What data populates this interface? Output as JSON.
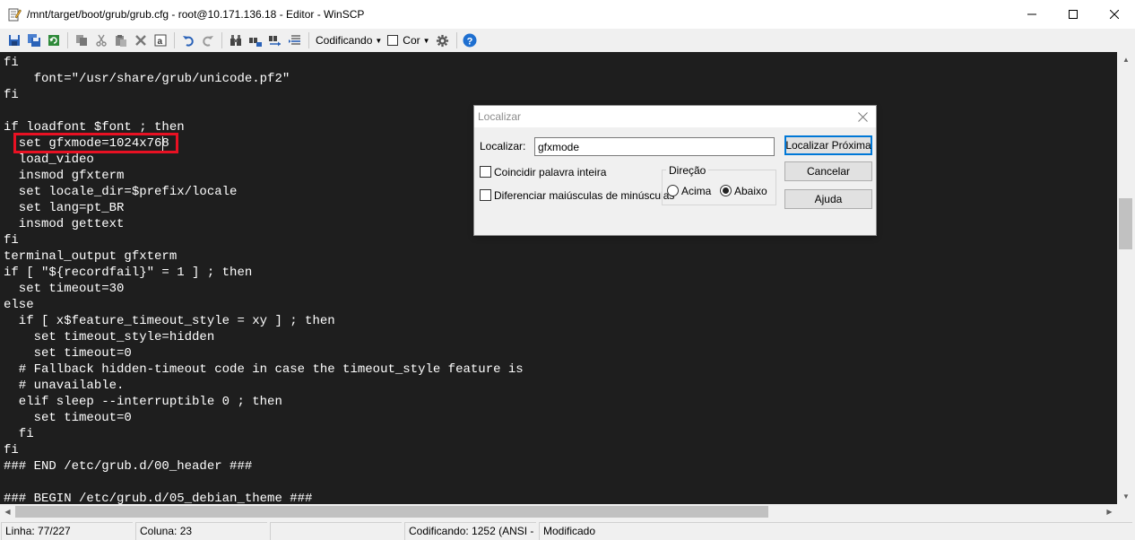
{
  "window": {
    "title": "/mnt/target/boot/grub/grub.cfg - root@10.171.136.18 - Editor - WinSCP"
  },
  "toolbar": {
    "encoding_label": "Codificando",
    "color_label": "Cor"
  },
  "editor": {
    "lines": [
      "fi",
      "    font=\"/usr/share/grub/unicode.pf2\"",
      "fi",
      "",
      "if loadfont $font ; then",
      "  set gfxmode=1024x768",
      "  load_video",
      "  insmod gfxterm",
      "  set locale_dir=$prefix/locale",
      "  set lang=pt_BR",
      "  insmod gettext",
      "fi",
      "terminal_output gfxterm",
      "if [ \"${recordfail}\" = 1 ] ; then",
      "  set timeout=30",
      "else",
      "  if [ x$feature_timeout_style = xy ] ; then",
      "    set timeout_style=hidden",
      "    set timeout=0",
      "  # Fallback hidden-timeout code in case the timeout_style feature is",
      "  # unavailable.",
      "  elif sleep --interruptible 0 ; then",
      "    set timeout=0",
      "  fi",
      "fi",
      "### END /etc/grub.d/00_header ###",
      "",
      "### BEGIN /etc/grub.d/05_debian_theme ###"
    ]
  },
  "statusbar": {
    "line": "Linha: 77/227",
    "column": "Coluna: 23",
    "encoding": "Codificando: 1252  (ANSI -",
    "state": "Modificado"
  },
  "find_dialog": {
    "title": "Localizar",
    "find_label": "Localizar:",
    "find_value": "gfxmode",
    "whole_word_label": "Coincidir palavra inteira",
    "match_case_label": "Diferenciar maiúsculas de minúsculas",
    "direction_label": "Direção",
    "up_label": "Acima",
    "down_label": "Abaixo",
    "find_next_button": "Localizar Próxima",
    "cancel_button": "Cancelar",
    "help_button": "Ajuda"
  }
}
